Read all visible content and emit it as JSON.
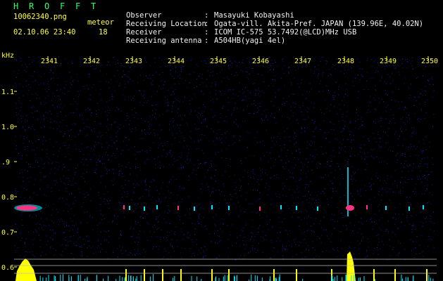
{
  "app": {
    "title": "HROFFT",
    "filename": "10062340.png",
    "datetime": "02.10.06 23:40",
    "meteor_label": "meteor",
    "meteor_count": "18"
  },
  "info": [
    {
      "key": "Observer",
      "sep": ":",
      "value": "Masayuki Kobayashi"
    },
    {
      "key": "Receiving Location",
      "sep": ":",
      "value": "Ogata-vill. Akita-Pref. JAPAN (139.96E, 40.02N)"
    },
    {
      "key": "Receiver",
      "sep": ":",
      "value": "ICOM IC-575 53.7492(@LCD)MHz USB"
    },
    {
      "key": "Receiving antenna",
      "sep": ":",
      "value": "A504HB(yagi 4el)"
    }
  ],
  "axes": {
    "y_unit": "kHz",
    "y_ticks": [
      "1.1",
      "1.0",
      ".9",
      "0.8",
      "0.7",
      "0.6"
    ],
    "x_ticks": [
      "2341",
      "2342",
      "2343",
      "2344",
      "2345",
      "2346",
      "2347",
      "2348",
      "2349",
      "2350"
    ]
  },
  "colors": {
    "background": "#000000",
    "noise": "#1a1a9a",
    "signal_core": "#ff3380",
    "signal_edge": "#00e6ff",
    "histogram": "#ffff00",
    "labels": "#ffff3a",
    "title": "#33ff66",
    "info_text": "#f2f2f2"
  }
}
